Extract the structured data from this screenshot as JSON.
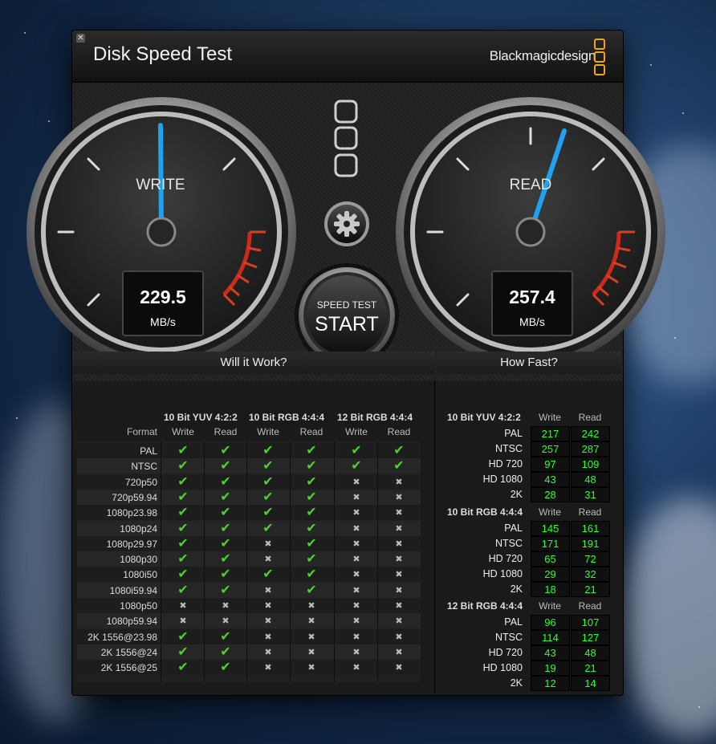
{
  "window": {
    "title": "Disk Speed Test",
    "close_glyph": "✕"
  },
  "brand": {
    "name": "Blackmagicdesign"
  },
  "gauges": {
    "write": {
      "label": "WRITE",
      "value": "229.5",
      "unit": "MB/s"
    },
    "read": {
      "label": "READ",
      "value": "257.4",
      "unit": "MB/s"
    }
  },
  "start": {
    "small": "SPEED TEST",
    "big": "START"
  },
  "will_it_work": {
    "title": "Will it Work?",
    "format_label": "Format",
    "groups": [
      "10 Bit YUV 4:2:2",
      "10 Bit RGB 4:4:4",
      "12 Bit RGB 4:4:4"
    ],
    "sub": [
      "Write",
      "Read"
    ],
    "rows": [
      {
        "format": "PAL",
        "v": [
          1,
          1,
          1,
          1,
          1,
          1
        ]
      },
      {
        "format": "NTSC",
        "v": [
          1,
          1,
          1,
          1,
          1,
          1
        ]
      },
      {
        "format": "720p50",
        "v": [
          1,
          1,
          1,
          1,
          0,
          0
        ]
      },
      {
        "format": "720p59.94",
        "v": [
          1,
          1,
          1,
          1,
          0,
          0
        ]
      },
      {
        "format": "1080p23.98",
        "v": [
          1,
          1,
          1,
          1,
          0,
          0
        ]
      },
      {
        "format": "1080p24",
        "v": [
          1,
          1,
          1,
          1,
          0,
          0
        ]
      },
      {
        "format": "1080p29.97",
        "v": [
          1,
          1,
          0,
          1,
          0,
          0
        ]
      },
      {
        "format": "1080p30",
        "v": [
          1,
          1,
          0,
          1,
          0,
          0
        ]
      },
      {
        "format": "1080i50",
        "v": [
          1,
          1,
          1,
          1,
          0,
          0
        ]
      },
      {
        "format": "1080i59.94",
        "v": [
          1,
          1,
          0,
          1,
          0,
          0
        ]
      },
      {
        "format": "1080p50",
        "v": [
          0,
          0,
          0,
          0,
          0,
          0
        ]
      },
      {
        "format": "1080p59.94",
        "v": [
          0,
          0,
          0,
          0,
          0,
          0
        ]
      },
      {
        "format": "2K 1556@23.98",
        "v": [
          1,
          1,
          0,
          0,
          0,
          0
        ]
      },
      {
        "format": "2K 1556@24",
        "v": [
          1,
          1,
          0,
          0,
          0,
          0
        ]
      },
      {
        "format": "2K 1556@25",
        "v": [
          1,
          1,
          0,
          0,
          0,
          0
        ]
      }
    ]
  },
  "how_fast": {
    "title": "How Fast?",
    "write_label": "Write",
    "read_label": "Read",
    "groups": [
      {
        "name": "10 Bit YUV 4:2:2",
        "rows": [
          {
            "label": "PAL",
            "write": "217",
            "read": "242"
          },
          {
            "label": "NTSC",
            "write": "257",
            "read": "287"
          },
          {
            "label": "HD 720",
            "write": "97",
            "read": "109"
          },
          {
            "label": "HD 1080",
            "write": "43",
            "read": "48"
          },
          {
            "label": "2K",
            "write": "28",
            "read": "31"
          }
        ]
      },
      {
        "name": "10 Bit RGB 4:4:4",
        "rows": [
          {
            "label": "PAL",
            "write": "145",
            "read": "161"
          },
          {
            "label": "NTSC",
            "write": "171",
            "read": "191"
          },
          {
            "label": "HD 720",
            "write": "65",
            "read": "72"
          },
          {
            "label": "HD 1080",
            "write": "29",
            "read": "32"
          },
          {
            "label": "2K",
            "write": "18",
            "read": "21"
          }
        ]
      },
      {
        "name": "12 Bit RGB 4:4:4",
        "rows": [
          {
            "label": "PAL",
            "write": "96",
            "read": "107"
          },
          {
            "label": "NTSC",
            "write": "114",
            "read": "127"
          },
          {
            "label": "HD 720",
            "write": "43",
            "read": "48"
          },
          {
            "label": "HD 1080",
            "write": "19",
            "read": "21"
          },
          {
            "label": "2K",
            "write": "12",
            "read": "14"
          }
        ]
      }
    ]
  }
}
